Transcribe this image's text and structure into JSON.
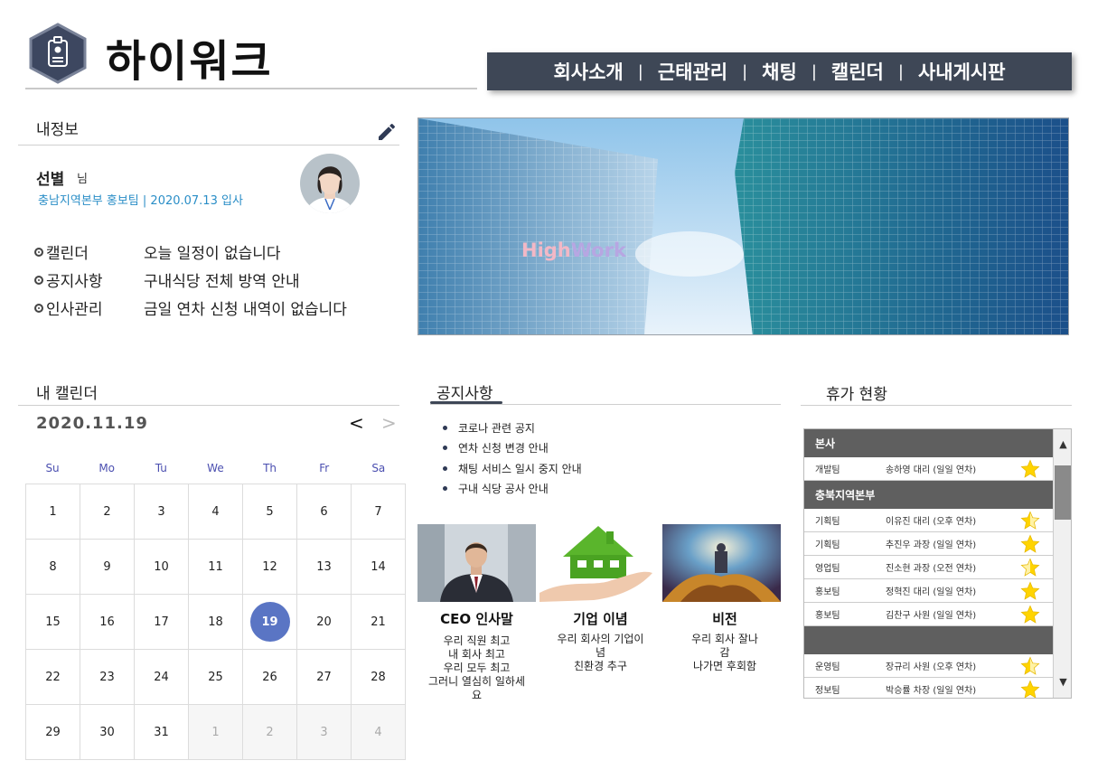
{
  "header": {
    "brand": "하이워크",
    "nav": [
      "회사소개",
      "근태관리",
      "채팅",
      "캘린더",
      "사내게시판"
    ],
    "nav_separator": "|"
  },
  "my_info": {
    "title": "내정보",
    "name": "선별",
    "suffix": "님",
    "dept": "충남지역본부  홍보팀  |   2020.07.13  입사",
    "rows": [
      {
        "label": "캘린더",
        "value": "오늘 일정이 없습니다"
      },
      {
        "label": "공지사항",
        "value": "구내식당 전체 방역 안내"
      },
      {
        "label": "인사관리",
        "value": "금일 연차 신청 내역이 없습니다"
      }
    ]
  },
  "banner": {
    "logo_high": "High",
    "logo_work": "Work"
  },
  "calendar": {
    "title": "내 캘린더",
    "date": "2020.11.19",
    "prev": "<",
    "next": ">",
    "weekdays": [
      "Su",
      "Mo",
      "Tu",
      "We",
      "Th",
      "Fr",
      "Sa"
    ],
    "days": [
      "1",
      "2",
      "3",
      "4",
      "5",
      "6",
      "7",
      "8",
      "9",
      "10",
      "11",
      "12",
      "13",
      "14",
      "15",
      "16",
      "17",
      "18",
      "19",
      "20",
      "21",
      "22",
      "23",
      "24",
      "25",
      "26",
      "27",
      "28",
      "29",
      "30",
      "31",
      "1",
      "2",
      "3",
      "4"
    ],
    "today": "19"
  },
  "notices": {
    "title": "공지사항",
    "items": [
      "코로나 관련 공지",
      "연차 신청 변경 안내",
      "채팅 서비스 일시 중지 안내",
      "구내 식당 공사 안내"
    ]
  },
  "cards": [
    {
      "title": "CEO 인사말",
      "lines": [
        "우리 직원 최고",
        "내 회사 최고",
        "우리 모두 최고",
        "그러니 열심히 일하세",
        "요"
      ]
    },
    {
      "title": "기업 이념",
      "lines": [
        "우리 회사의 기업이",
        "념",
        "친환경 추구"
      ]
    },
    {
      "title": "비전",
      "lines": [
        "우리 회사 잘나",
        "감",
        "나가면 후회함"
      ]
    }
  ],
  "vacation": {
    "title": "휴가 현황",
    "groups": [
      {
        "name": "본사",
        "rows": [
          {
            "team": "개발팀",
            "who": "송하영 대리 (일일 연차)",
            "star": "full"
          }
        ]
      },
      {
        "name": "충북지역본부",
        "rows": [
          {
            "team": "기획팀",
            "who": "이유진 대리 (오후 연차)",
            "star": "half"
          },
          {
            "team": "기획팀",
            "who": "추진우 과장 (일일 연차)",
            "star": "full"
          },
          {
            "team": "영업팀",
            "who": "진소현 과장 (오전 연차)",
            "star": "half"
          },
          {
            "team": "홍보팀",
            "who": "정혁진 대리 (일일 연차)",
            "star": "full"
          },
          {
            "team": "홍보팀",
            "who": "김찬구 사원 (일일 연차)",
            "star": "full"
          }
        ]
      },
      {
        "name": "",
        "rows": [
          {
            "team": "운영팀",
            "who": "장규리 사원 (오후 연차)",
            "star": "half"
          },
          {
            "team": "정보팀",
            "who": "박승률 차장 (일일 연차)",
            "star": "full"
          }
        ]
      }
    ],
    "scroll_up": "▲",
    "scroll_down": "▼"
  },
  "colors": {
    "nav_bg": "#3e4756",
    "accent_blue": "#2a8ec7",
    "today_circle": "#5a75c4",
    "weekday_text": "#4b4fb0",
    "star": "#ffd400"
  }
}
